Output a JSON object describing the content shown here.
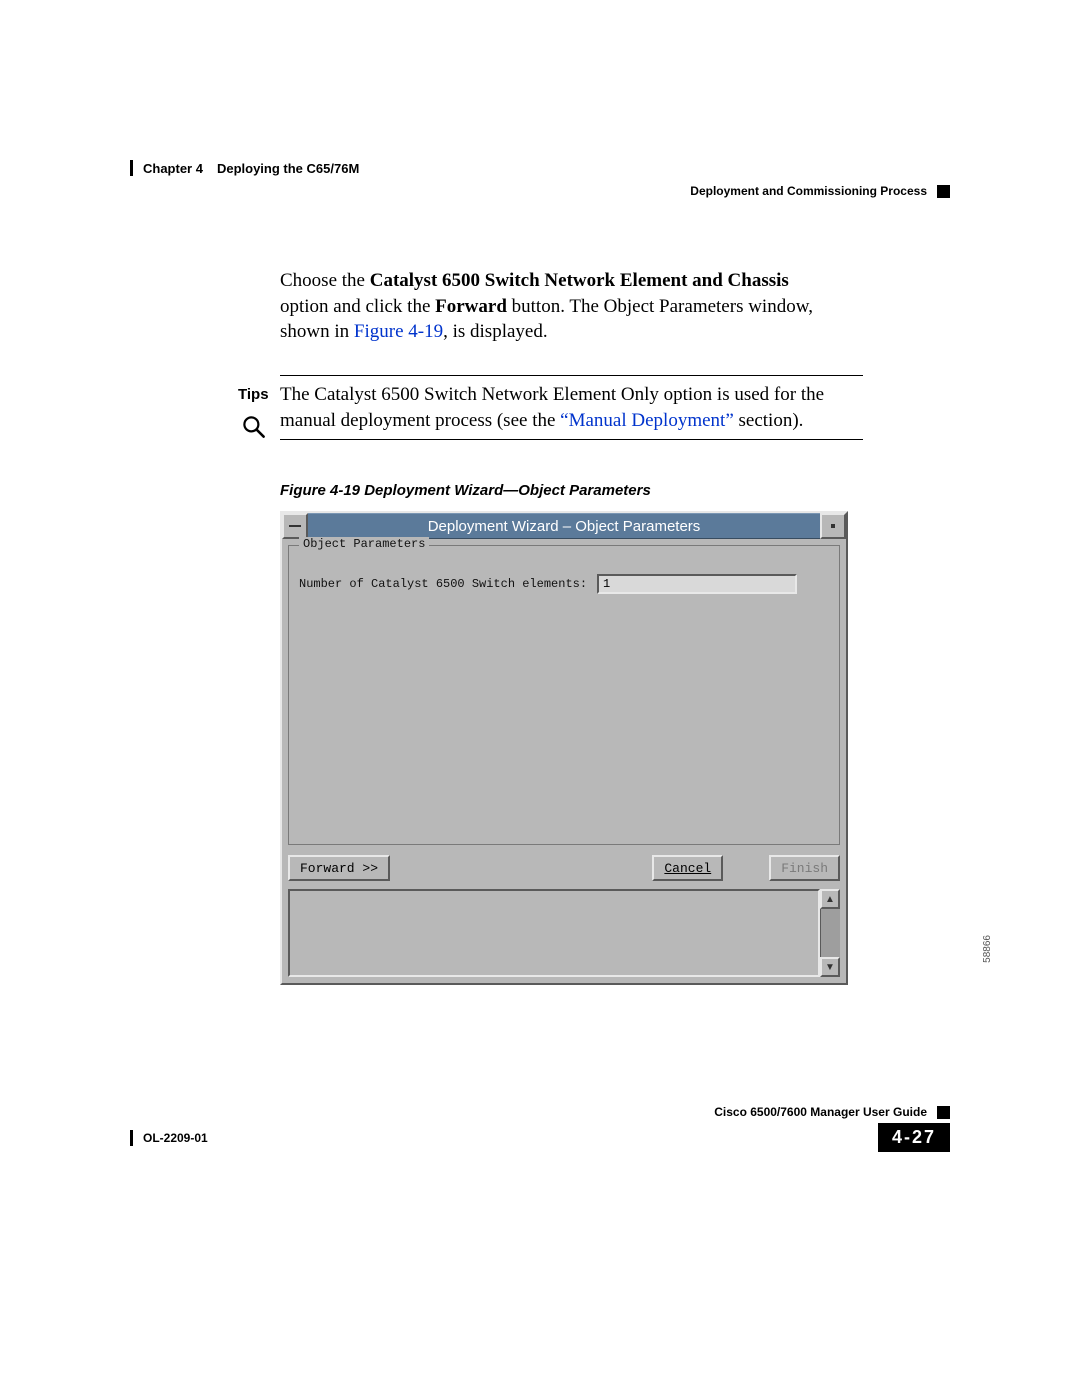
{
  "header": {
    "chapter_label": "Chapter 4",
    "chapter_title": "Deploying the C65/76M",
    "section": "Deployment and Commissioning Process"
  },
  "body": {
    "p1_a": "Choose the ",
    "p1_bold": "Catalyst 6500 Switch Network Element and Chassis",
    "p1_b": " option and click the ",
    "p1_bold2": "Forward",
    "p1_c": " button. The Object Parameters window, shown in ",
    "p1_link": "Figure 4-19",
    "p1_d": ", is displayed."
  },
  "tips": {
    "label": "Tips",
    "t1": "The Catalyst 6500 Switch Network Element Only option is used for the manual deployment process (see the ",
    "link": "“Manual Deployment”",
    "t2": " section)."
  },
  "figure": {
    "caption": "Figure 4-19   Deployment Wizard—Object Parameters",
    "image_id": "58866"
  },
  "wizard": {
    "title": "Deployment Wizard – Object Parameters",
    "group_label": "Object Parameters",
    "field_label": "Number of Catalyst 6500 Switch elements:",
    "field_value": "1",
    "buttons": {
      "forward": "Forward >>",
      "cancel": "Cancel",
      "finish": "Finish"
    }
  },
  "footer": {
    "guide": "Cisco 6500/7600 Manager User Guide",
    "doc_id": "OL-2209-01",
    "page": "4-27"
  }
}
